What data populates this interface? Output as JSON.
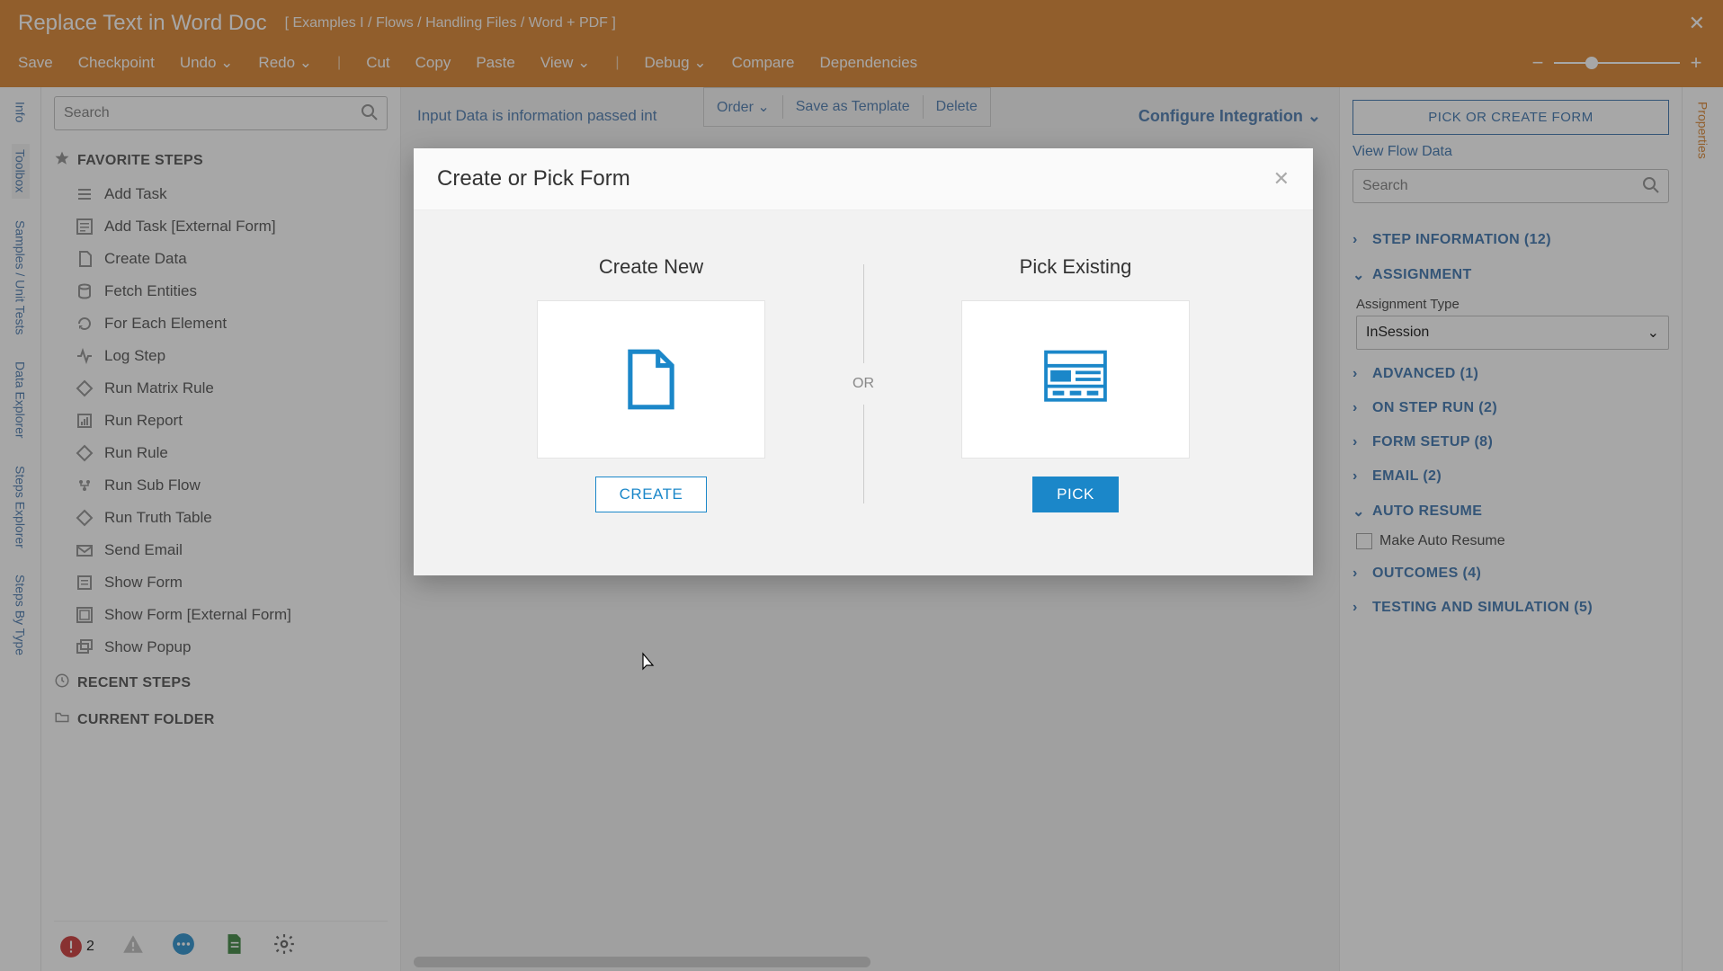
{
  "header": {
    "title": "Replace Text in Word Doc",
    "breadcrumb": "[ Examples I / Flows / Handling Files / Word + PDF ]",
    "menu": [
      "Save",
      "Checkpoint",
      "Undo",
      "Redo",
      "Cut",
      "Copy",
      "Paste",
      "View",
      "Debug",
      "Compare",
      "Dependencies"
    ],
    "menu_dropdowns": [
      false,
      false,
      true,
      true,
      false,
      false,
      false,
      true,
      true,
      false,
      false
    ]
  },
  "left_rail": [
    "Info",
    "Toolbox",
    "Samples / Unit Tests",
    "Data Explorer",
    "Steps Explorer",
    "Steps By Type"
  ],
  "left_rail_active": 1,
  "right_rail": [
    "Properties"
  ],
  "toolbox": {
    "search_placeholder": "Search",
    "favorite_header": "FAVORITE STEPS",
    "recent_header": "RECENT STEPS",
    "current_folder_header": "CURRENT FOLDER",
    "favorite_steps": [
      {
        "label": "Add Task",
        "icon": "list"
      },
      {
        "label": "Add Task [External Form]",
        "icon": "list-box"
      },
      {
        "label": "Create Data",
        "icon": "page"
      },
      {
        "label": "Fetch Entities",
        "icon": "db"
      },
      {
        "label": "For Each Element",
        "icon": "loop"
      },
      {
        "label": "Log Step",
        "icon": "pulse"
      },
      {
        "label": "Run Matrix Rule",
        "icon": "diamond"
      },
      {
        "label": "Run Report",
        "icon": "report"
      },
      {
        "label": "Run Rule",
        "icon": "diamond"
      },
      {
        "label": "Run Sub Flow",
        "icon": "subflow"
      },
      {
        "label": "Run Truth Table",
        "icon": "diamond"
      },
      {
        "label": "Send Email",
        "icon": "mail"
      },
      {
        "label": "Show Form",
        "icon": "form"
      },
      {
        "label": "Show Form [External Form]",
        "icon": "form-box"
      },
      {
        "label": "Show Popup",
        "icon": "popup"
      }
    ],
    "error_count": "2"
  },
  "canvas": {
    "hint": "Input Data is information passed int",
    "float_menu": [
      "Order",
      "Save as Template",
      "Delete"
    ],
    "float_menu_dropdown": [
      true,
      false,
      false
    ],
    "configure_label": "Configure Integration"
  },
  "props": {
    "pick_button": "PICK OR CREATE FORM",
    "view_flow_link": "View Flow Data",
    "search_placeholder": "Search",
    "accordion": [
      {
        "label": "STEP INFORMATION (12)",
        "open": false
      },
      {
        "label": "ASSIGNMENT",
        "open": true
      },
      {
        "label": "ADVANCED (1)",
        "open": false
      },
      {
        "label": "ON STEP RUN (2)",
        "open": false
      },
      {
        "label": "FORM SETUP (8)",
        "open": false
      },
      {
        "label": "EMAIL (2)",
        "open": false
      },
      {
        "label": "AUTO RESUME",
        "open": true
      },
      {
        "label": "OUTCOMES (4)",
        "open": false
      },
      {
        "label": "TESTING AND SIMULATION (5)",
        "open": false
      }
    ],
    "assignment_type_label": "Assignment Type",
    "assignment_type_value": "InSession",
    "auto_resume_checkbox": "Make Auto Resume"
  },
  "modal": {
    "title": "Create or Pick Form",
    "create_title": "Create New",
    "pick_title": "Pick Existing",
    "or_label": "OR",
    "create_button": "CREATE",
    "pick_button": "PICK"
  },
  "colors": {
    "brand": "#d87b1f",
    "link": "#2f6aa8",
    "accent": "#1b87c9"
  }
}
